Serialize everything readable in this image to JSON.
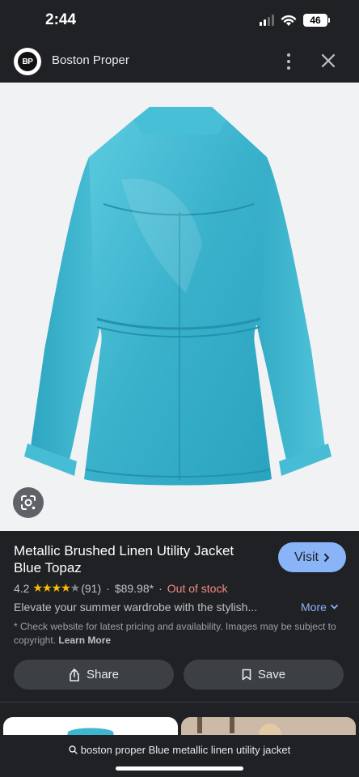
{
  "status_bar": {
    "time": "2:44",
    "battery": "46"
  },
  "header": {
    "logo_text": "BP",
    "site_name": "Boston Proper"
  },
  "product": {
    "title": "Metallic Brushed Linen Utility Jacket Blue Topaz",
    "rating": "4.2",
    "stars_filled": 4,
    "review_count": "(91)",
    "separator": "·",
    "price": "$89.98*",
    "stock_status": "Out of stock",
    "description": "Elevate your summer wardrobe with the stylish...",
    "more_label": "More",
    "disclaimer": "* Check website for latest pricing and availability. Images may be subject to copyright.",
    "learn_more": "Learn More"
  },
  "buttons": {
    "visit": "Visit",
    "share": "Share",
    "save": "Save"
  },
  "search": {
    "query": "boston proper Blue metallic linen utility jacket"
  },
  "colors": {
    "accent": "#8ab4f8",
    "out_of_stock": "#f28b82",
    "star": "#fbbc04",
    "jacket": "#3fb6cf"
  }
}
